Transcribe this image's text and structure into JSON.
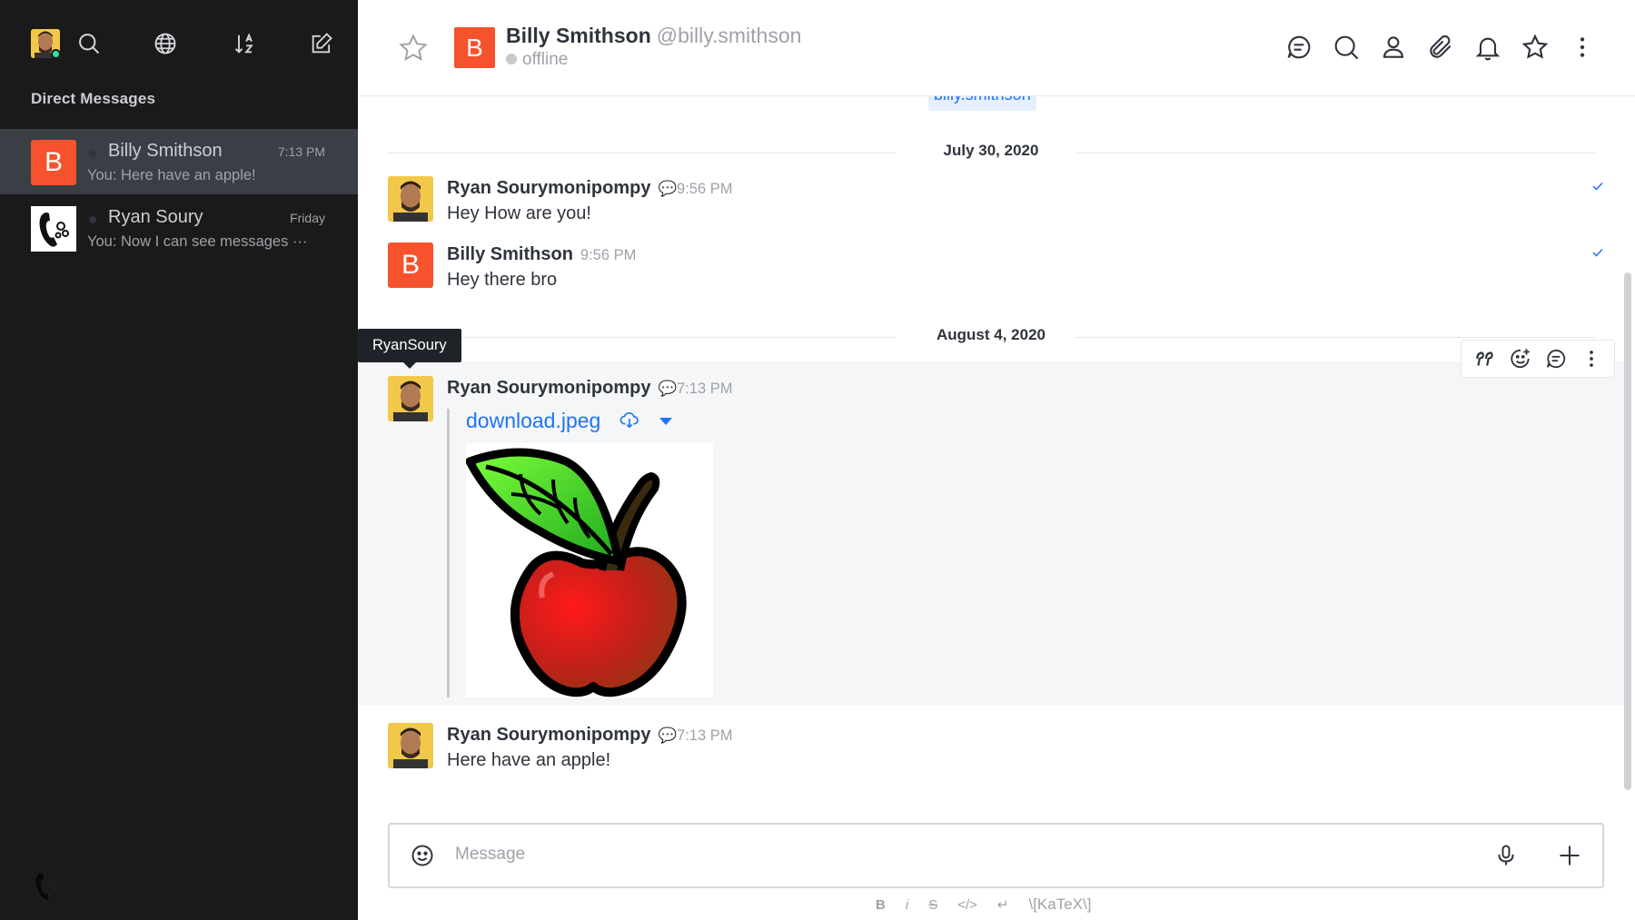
{
  "sidebar": {
    "section_title": "Direct Messages",
    "icons": [
      "avatar",
      "search-icon",
      "globe-icon",
      "sort-icon",
      "edit-icon"
    ],
    "items": [
      {
        "avatar_letter": "B",
        "name": "Billy Smithson",
        "time": "7:13 PM",
        "last_message": "You: Here have an apple!",
        "active": true,
        "status_color": "#2f343d"
      },
      {
        "avatar_letter": "",
        "name": "Ryan Soury",
        "time": "Friday",
        "last_message": "You: Now I can see messages ···",
        "active": false,
        "status_color": "#2f343d"
      }
    ]
  },
  "header": {
    "avatar_letter": "B",
    "name": "Billy Smithson",
    "username": "@billy.smithson",
    "status": "offline",
    "icons": [
      "thread-icon",
      "search-icon",
      "user-icon",
      "paperclip-icon",
      "bell-icon",
      "star-icon",
      "kebab-icon"
    ]
  },
  "messages": {
    "top_chip": "billy.smithson",
    "dates": [
      "July 30, 2020",
      "August 4, 2020"
    ],
    "list": [
      {
        "author": "Ryan Sourymonipompy",
        "time": "9:56 PM",
        "text": "Hey How are you!"
      },
      {
        "author": "Billy Smithson",
        "time": "9:56 PM",
        "text": "Hey there bro",
        "avatar_letter": "B"
      },
      {
        "author": "Ryan Sourymonipompy",
        "time": "7:13 PM",
        "attachment": "download.jpeg"
      },
      {
        "author": "Ryan Sourymonipompy",
        "time": "7:13 PM",
        "text": "Here have an apple!"
      }
    ],
    "tooltip": "RyanSoury"
  },
  "composer": {
    "placeholder": "Message",
    "format": {
      "bold": "B",
      "italic": "i",
      "strike": "S",
      "code": "</>",
      "multiline": "↵",
      "katex": "\\[KaTeX\\]"
    }
  },
  "colors": {
    "brand": "#f5522d",
    "link": "#1d74f5",
    "sidebar_bg": "#1a1a1a"
  }
}
